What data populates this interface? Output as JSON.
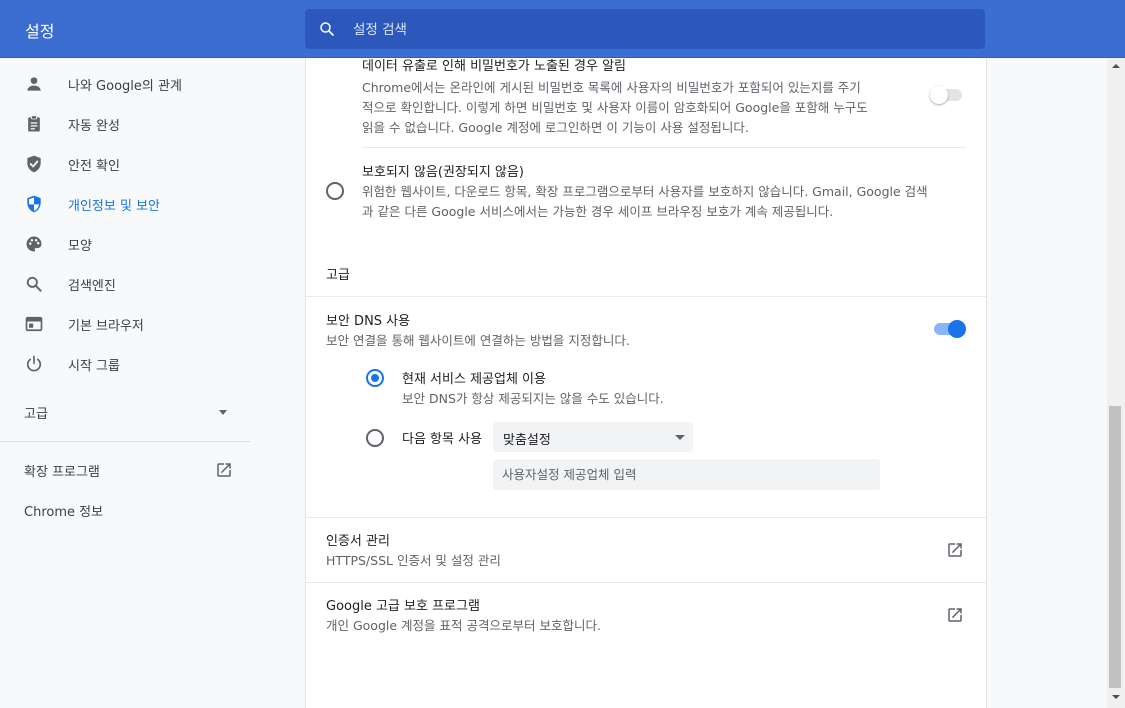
{
  "header": {
    "title": "설정",
    "search_placeholder": "설정 검색"
  },
  "sidebar": {
    "items": [
      {
        "label": "나와 Google의 관계",
        "icon": "person-icon",
        "active": false
      },
      {
        "label": "자동 완성",
        "icon": "clipboard-icon",
        "active": false
      },
      {
        "label": "안전 확인",
        "icon": "shield-check-icon",
        "active": false
      },
      {
        "label": "개인정보 및 보안",
        "icon": "shield-icon",
        "active": true
      },
      {
        "label": "모양",
        "icon": "palette-icon",
        "active": false
      },
      {
        "label": "검색엔진",
        "icon": "search-icon",
        "active": false
      },
      {
        "label": "기본 브라우저",
        "icon": "browser-icon",
        "active": false
      },
      {
        "label": "시작 그룹",
        "icon": "power-icon",
        "active": false
      }
    ],
    "advanced_label": "고급",
    "extensions_label": "확장 프로그램",
    "about_label": "Chrome 정보"
  },
  "main": {
    "leak_alert": {
      "title": "데이터 유출로 인해 비밀번호가 노출된 경우 알림",
      "desc_lines": [
        "Chrome에서는 온라인에 게시된 비밀번호 목록에 사용자의 비밀번호가 포함되어 있는지를 주기",
        "적으로 확인합니다. 이렇게 하면 비밀번호 및 사용자 이름이 암호화되어 Google을 포함해 누구도",
        "읽을 수 없습니다. Google 계정에 로그인하면 이 기능이 사용 설정됩니다."
      ],
      "enabled": false
    },
    "no_protection": {
      "title": "보호되지 않음(권장되지 않음)",
      "desc_lines": [
        "위험한 웹사이트, 다운로드 항목, 확장 프로그램으로부터 사용자를 보호하지 않습니다. Gmail, Google 검색",
        "과 같은 다른 Google 서비스에서는 가능한 경우 세이프 브라우징 보호가 계속 제공됩니다."
      ],
      "selected": false
    },
    "advanced_heading": "고급",
    "secure_dns": {
      "title": "보안 DNS 사용",
      "desc": "보안 연결을 통해 웹사이트에 연결하는 방법을 지정합니다.",
      "enabled": true,
      "option_current": {
        "label": "현재 서비스 제공업체 이용",
        "desc": "보안 DNS가 항상 제공되지는 않을 수도 있습니다.",
        "selected": true
      },
      "option_custom": {
        "label": "다음 항목 사용",
        "selected": false,
        "select_value": "맞춤설정",
        "input_placeholder": "사용자설정 제공업체 입력"
      }
    },
    "certificates": {
      "title": "인증서 관리",
      "desc": "HTTPS/SSL 인증서 및 설정 관리",
      "icon": "open-in-new-icon"
    },
    "advanced_protection": {
      "title": "Google 고급 보호 프로그램",
      "desc": "개인 Google 계정을 표적 공격으로부터 보호합니다.",
      "icon": "open-in-new-icon"
    }
  },
  "colors": {
    "header_bg": "#3c6ed2",
    "search_bg": "#2d58bb",
    "accent": "#1a73e8",
    "page_bg": "#f8f9fa"
  }
}
